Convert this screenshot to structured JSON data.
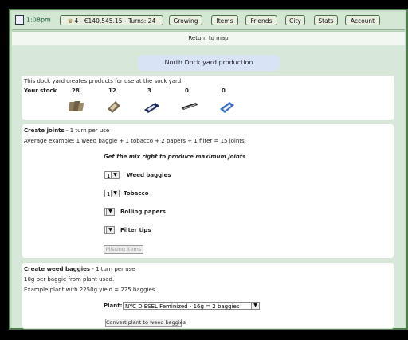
{
  "topbar": {
    "time": "1:08pm",
    "status": "4 - €140,545.15 - Turns: 24",
    "nav": [
      "Growing",
      "Items",
      "Friends",
      "City",
      "Stats",
      "Account"
    ]
  },
  "map_link": "Return to map",
  "title": "North Dock yard production",
  "intro": "This dock yard creates products for use at the sock yard.",
  "stock": {
    "label": "Your stock",
    "counts": [
      "28",
      "12",
      "3",
      "0",
      "0"
    ]
  },
  "joints": {
    "heading": "Create joints",
    "turn": "-   1 turn per use",
    "example": "Average example: 1 weed baggie + 1 tobacco + 2 papers + 1 filter = 15 joints.",
    "hint": "Get the mix right to produce maximum joints",
    "rows": [
      {
        "value": "1",
        "label": "Weed baggies"
      },
      {
        "value": "1",
        "label": "Tobacco"
      },
      {
        "value": "",
        "label": "Rolling papers"
      },
      {
        "value": "",
        "label": "Filter tips"
      }
    ],
    "button": "Missing items"
  },
  "baggies": {
    "heading": "Create weed baggies",
    "turn": "-   1 turn per use",
    "line1": "10g per baggie from plant used.",
    "line2": "Example plant with 2250g yield = 225 baggies.",
    "plant_label": "Plant:",
    "plant_value": "NYC DIESEL Feminized - 16g = 2 baggies",
    "button": "Convert plant to weed baggies"
  }
}
